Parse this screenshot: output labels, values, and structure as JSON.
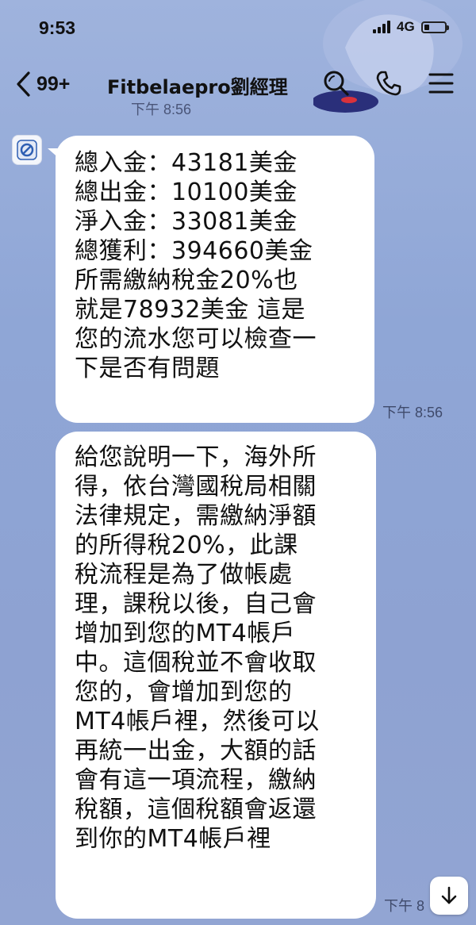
{
  "status_bar": {
    "time": "9:53",
    "network": "4G"
  },
  "header": {
    "unread_count": "99+",
    "title": "Fitbelaepro劉經理",
    "icons": [
      "back-chevron-icon",
      "search-icon",
      "phone-icon",
      "menu-icon"
    ]
  },
  "previous_time_partial": "下午 8:56",
  "messages": [
    {
      "lines": [
        "總入金：43181美金",
        "總出金：10100美金",
        "淨入金：33081美金",
        "總獲利：394660美金",
        "所需繳納稅金20%也",
        "就是78932美金 這是",
        "您的流水您可以檢查一",
        "下是否有問題"
      ],
      "time": "下午 8:56"
    },
    {
      "lines": [
        "給您說明一下，海外所",
        "得，依台灣國稅局相關",
        "法律規定，需繳納淨額",
        "的所得稅20%，此課",
        "稅流程是為了做帳處",
        "理，課稅以後，自己會",
        "增加到您的MT4帳戶",
        "中。這個稅並不會收取",
        "您的，會增加到您的",
        "MT4帳戶裡，然後可以",
        "再統一出金，大額的話",
        "會有這一項流程，繳納",
        "稅額，這個稅額會返還",
        "到你的MT4帳戶裡"
      ],
      "time": "下午 8"
    }
  ],
  "colors": {
    "background": "#8fa6d6",
    "bubble": "#ffffff",
    "text": "#111111"
  }
}
